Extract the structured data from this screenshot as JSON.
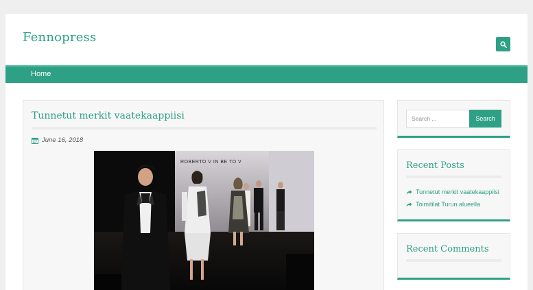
{
  "header": {
    "site_title": "Fennopress",
    "search_toggle_icon": "search-icon"
  },
  "nav": {
    "items": [
      {
        "label": "Home"
      }
    ]
  },
  "article": {
    "title": "Tunnetut merkit vaatekaappiisi",
    "date": "June 16, 2018",
    "date_icon": "calendar-icon",
    "image_signage": "ROBERTO V  IN   BE TO V"
  },
  "sidebar": {
    "search": {
      "placeholder": "Search ...",
      "button_label": "Search"
    },
    "recent_posts": {
      "title": "Recent Posts",
      "items": [
        {
          "label": "Tunnetut merkit vaatekaappiisi",
          "icon": "share-arrow-icon"
        },
        {
          "label": "Toimitilat Turun alueella",
          "icon": "share-arrow-icon"
        }
      ]
    },
    "recent_comments": {
      "title": "Recent Comments"
    }
  },
  "colors": {
    "accent": "#2ea085",
    "page_background": "#efefef",
    "panel_background": "#f7f7f7"
  }
}
